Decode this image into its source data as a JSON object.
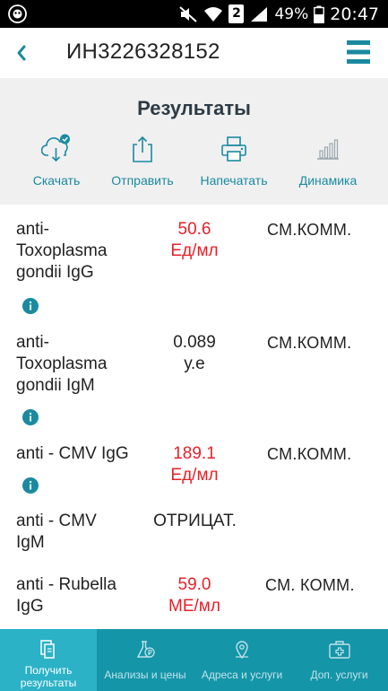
{
  "status_bar": {
    "battery": "49%",
    "time": "20:47",
    "sim": "2"
  },
  "header": {
    "order_id": "ИН3226328152"
  },
  "panel": {
    "title": "Результаты",
    "actions": [
      {
        "label": "Скачать",
        "icon": "cloud-download-icon"
      },
      {
        "label": "Отправить",
        "icon": "share-icon"
      },
      {
        "label": "Напечатать",
        "icon": "printer-icon"
      },
      {
        "label": "Динамика",
        "icon": "bar-chart-icon"
      }
    ]
  },
  "results": [
    {
      "name": [
        "anti-",
        "Toxoplasma",
        "gondii IgG"
      ],
      "value": "50.6",
      "unit": "Ед/мл",
      "abnormal": true,
      "comment": "СМ.КОММ.",
      "info": true
    },
    {
      "name": [
        "anti-",
        "Toxoplasma",
        "gondii IgM"
      ],
      "value": "0.089",
      "unit": "у.е",
      "abnormal": false,
      "comment": "СМ.КОММ.",
      "info": true
    },
    {
      "name": [
        "anti - CMV IgG"
      ],
      "value": "189.1",
      "unit": "Ед/мл",
      "abnormal": true,
      "comment": "СМ.КОММ.",
      "info": true
    },
    {
      "name": [
        "anti - CMV",
        "IgM"
      ],
      "value": "ОТРИЦАТ.",
      "unit": "",
      "abnormal": false,
      "comment": "",
      "info": false
    },
    {
      "name": [
        "anti - Rubella",
        "IgG"
      ],
      "value": "59.0",
      "unit": "МЕ/мл",
      "abnormal": true,
      "comment": "СМ. КОММ.",
      "info": false
    }
  ],
  "bottom_nav": [
    {
      "label": [
        "Получить",
        "результаты"
      ],
      "icon": "documents-icon",
      "active": true
    },
    {
      "label": [
        "Анализы и цены"
      ],
      "icon": "flask-ruble-icon",
      "active": false
    },
    {
      "label": [
        "Адреса и услуги"
      ],
      "icon": "map-pin-icon",
      "active": false
    },
    {
      "label": [
        "Доп. услуги"
      ],
      "icon": "medical-kit-icon",
      "active": false
    }
  ],
  "colors": {
    "accent": "#1a8aa0",
    "abnormal": "#e8202a",
    "nav_bg": "#1595a8",
    "nav_active": "#2bb2c6"
  }
}
